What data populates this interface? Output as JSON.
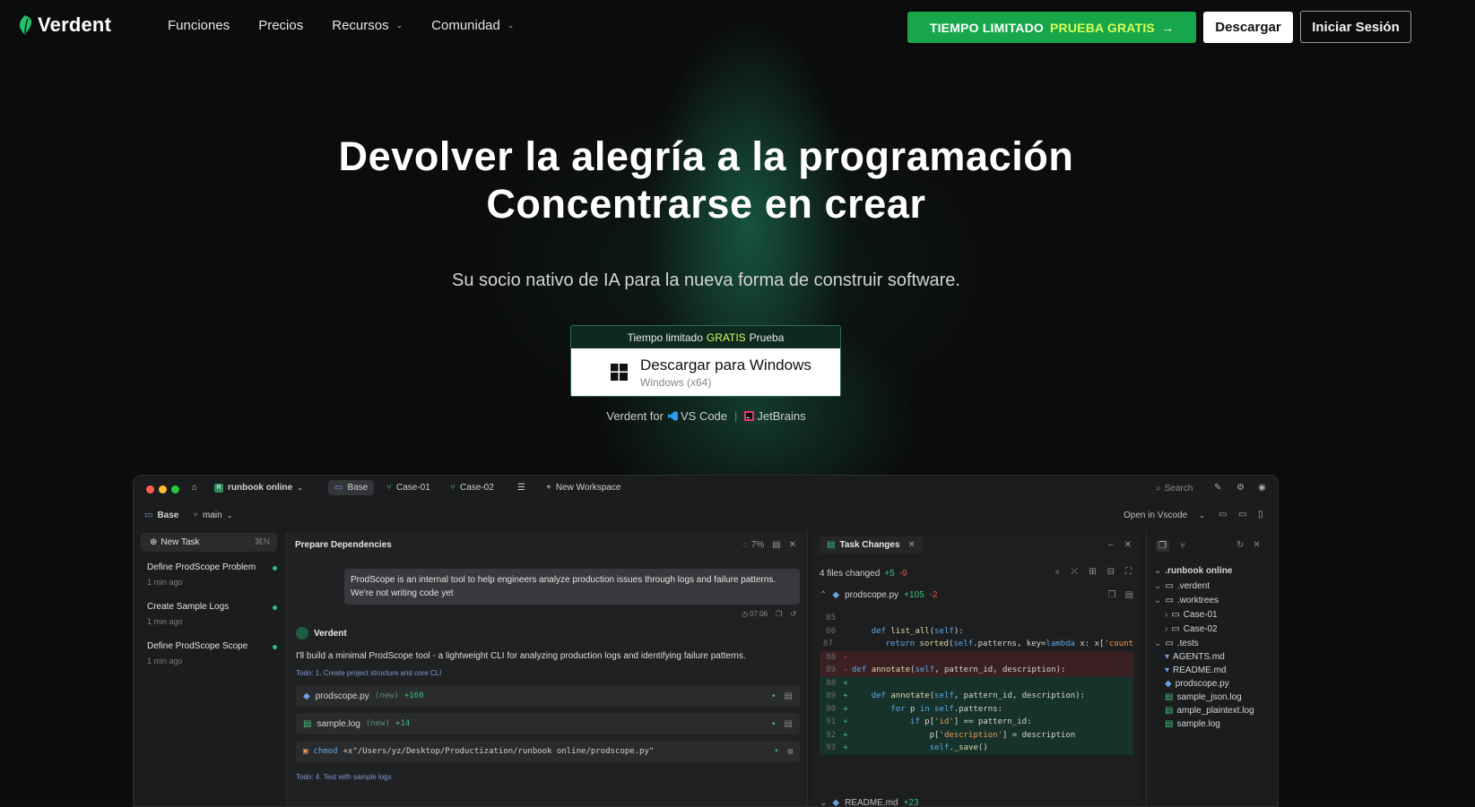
{
  "brand": {
    "name": "Verdent"
  },
  "nav": {
    "links": [
      "Funciones",
      "Precios",
      "Recursos",
      "Comunidad"
    ],
    "trial_text": "TIEMPO LIMITADO",
    "trial_highlight": "PRUEBA GRATIS",
    "download": "Descargar",
    "login": "Iniciar Sesión"
  },
  "hero": {
    "title_line1": "Devolver la alegría a la programación",
    "title_line2": "Concentrarse en crear",
    "subtitle": "Su socio nativo de IA para la nueva forma de construir software.",
    "cta_top_before": "Tiempo limitado",
    "cta_top_highlight": "GRATIS",
    "cta_top_after": "Prueba",
    "cta_label": "Descargar para Windows",
    "cta_sub": "Windows (x64)",
    "ide_prefix": "Verdent for",
    "ide_vscode": "VS Code",
    "ide_jetbrains": "JetBrains"
  },
  "colors": {
    "accent": "#17a74a",
    "highlight": "#d8ff5a",
    "background": "#0b0c0c"
  },
  "app": {
    "workspace": "runbook online",
    "tabs": [
      "Base",
      "Case-01",
      "Case-02"
    ],
    "new_workspace": "New Workspace",
    "search": "Search",
    "folder": "Base",
    "branch": "main",
    "open_in": "Open in Vscode",
    "new_task": "New Task",
    "new_task_shortcut": "⌘N",
    "tasks": [
      {
        "title": "Define ProdScope Problem",
        "time": "1 min ago"
      },
      {
        "title": "Create Sample Logs",
        "time": "1 min ago"
      },
      {
        "title": "Define ProdScope Scope",
        "time": "1 min ago"
      }
    ],
    "chat": {
      "title": "Prepare Dependencies",
      "progress": "7%",
      "user_message": "ProdScope is an internal tool to help engineers analyze production issues through logs and failure patterns. We're not writing code yet",
      "message_time": "07:06",
      "agent_name": "Verdent",
      "agent_text": "I'll build a minimal ProdScope tool - a lightweight CLI for analyzing production logs and identifying failure patterns.",
      "todo1": "Todo: 1. Create project structure and core CLI",
      "files": [
        {
          "name": "prodscope.py",
          "tag": "(new)",
          "added": "+160"
        },
        {
          "name": "sample.log",
          "tag": "(new)",
          "added": "+14"
        }
      ],
      "command_name": "chmod",
      "command_args": "+x\"/Users/yz/Desktop/Productization/runbook online/prodscope.py\"",
      "todo2": "Todo: 4. Test with sample logs"
    },
    "changes": {
      "tab": "Task Changes",
      "summary": "4 files changed",
      "added": "+5",
      "removed": "-9",
      "file": "prodscope.py",
      "file_added": "+105",
      "file_removed": "-2",
      "footer_file": "README.md",
      "footer_added": "+23"
    },
    "tree": {
      "root": ".runbook online",
      "items": [
        ".verdent",
        ".worktrees",
        "Case-01",
        "Case-02",
        ".tests",
        "AGENTS.md",
        "README.md",
        "prodscope.py",
        "sample_json.log",
        "ample_plaintext.log",
        "sample.log"
      ]
    }
  }
}
